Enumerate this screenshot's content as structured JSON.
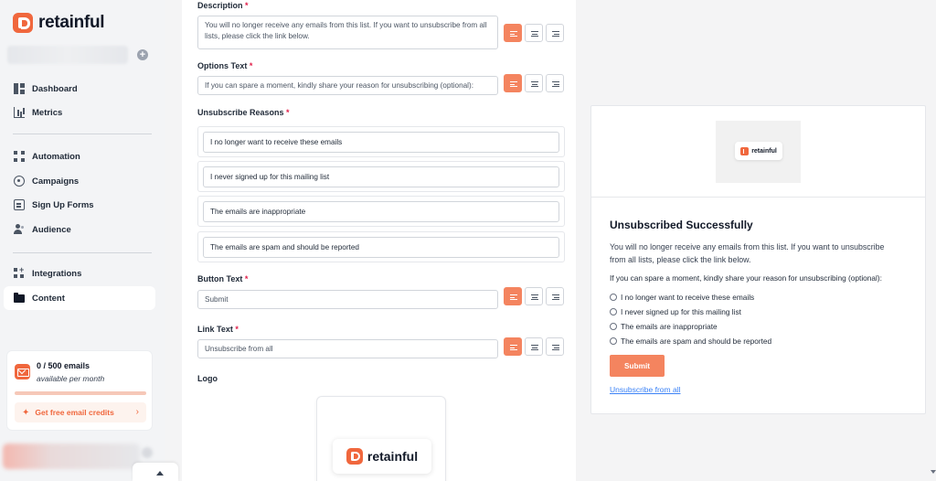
{
  "brand": {
    "name": "retainful",
    "accent": "#f0673d"
  },
  "sidebar": {
    "nav": [
      {
        "label": "Dashboard",
        "icon": "dashboard-icon"
      },
      {
        "label": "Metrics",
        "icon": "metrics-icon"
      },
      {
        "label": "Automation",
        "icon": "automation-icon"
      },
      {
        "label": "Campaigns",
        "icon": "campaigns-icon"
      },
      {
        "label": "Sign Up Forms",
        "icon": "signup-forms-icon"
      },
      {
        "label": "Audience",
        "icon": "audience-icon"
      },
      {
        "label": "Integrations",
        "icon": "integrations-icon"
      },
      {
        "label": "Content",
        "icon": "content-icon",
        "active": true
      }
    ],
    "credits": {
      "count": "0 / 500 emails",
      "per": "available per month",
      "cta": "Get free email credits"
    }
  },
  "form": {
    "description": {
      "label": "Description",
      "value": "You will no longer receive any emails from this list. If you want to unsubscribe from all lists, please click the link below."
    },
    "options_text": {
      "label": "Options Text",
      "value": "If you can spare a moment, kindly share your reason for unsubscribing (optional):"
    },
    "reasons": {
      "label": "Unsubscribe Reasons",
      "items": [
        "I no longer want to receive these emails",
        "I never signed up for this mailing list",
        "The emails are inappropriate",
        "The emails are spam and should be reported"
      ]
    },
    "button_text": {
      "label": "Button Text",
      "value": "Submit"
    },
    "link_text": {
      "label": "Link Text",
      "value": "Unsubscribe from all"
    },
    "logo": {
      "label": "Logo"
    },
    "required_mark": "*"
  },
  "preview": {
    "title": "Unsubscribed Successfully",
    "description": "You will no longer receive any emails from this list. If you want to unsubscribe from all lists, please click the link below.",
    "options_text": "If you can spare a moment, kindly share your reason for unsubscribing (optional):",
    "reasons": [
      "I no longer want to receive these emails",
      "I never signed up for this mailing list",
      "The emails are inappropriate",
      "The emails are spam and should be reported"
    ],
    "submit": "Submit",
    "link": "Unsubscribe from all"
  }
}
